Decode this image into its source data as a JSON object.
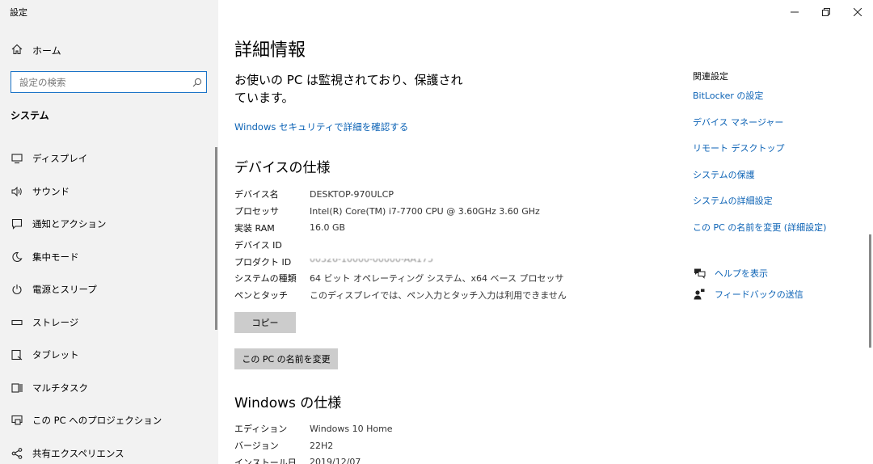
{
  "window": {
    "title": "設定"
  },
  "sidebar": {
    "home_label": "ホーム",
    "search_placeholder": "設定の検索",
    "section": "システム",
    "items": [
      {
        "label": "ディスプレイ",
        "icon": "display-icon"
      },
      {
        "label": "サウンド",
        "icon": "speaker-icon"
      },
      {
        "label": "通知とアクション",
        "icon": "notification-icon"
      },
      {
        "label": "集中モード",
        "icon": "moon-icon"
      },
      {
        "label": "電源とスリープ",
        "icon": "power-icon"
      },
      {
        "label": "ストレージ",
        "icon": "storage-icon"
      },
      {
        "label": "タブレット",
        "icon": "tablet-icon"
      },
      {
        "label": "マルチタスク",
        "icon": "multitask-icon"
      },
      {
        "label": "この PC へのプロジェクション",
        "icon": "projection-icon"
      },
      {
        "label": "共有エクスペリエンス",
        "icon": "share-icon"
      }
    ]
  },
  "main": {
    "title": "詳細情報",
    "protection_message": "お使いの PC は監視されており、保護されています。",
    "security_link": "Windows セキュリティで詳細を確認する",
    "device_spec": {
      "heading": "デバイスの仕様",
      "rows": [
        {
          "key": "デバイス名",
          "value": "DESKTOP-970ULCP"
        },
        {
          "key": "プロセッサ",
          "value": "Intel(R) Core(TM) i7-7700 CPU @ 3.60GHz   3.60 GHz"
        },
        {
          "key": "実装 RAM",
          "value": "16.0 GB"
        },
        {
          "key": "デバイス ID",
          "value": ""
        },
        {
          "key": "プロダクト ID",
          "value": "00326-10000-00000-AA175"
        },
        {
          "key": "システムの種類",
          "value": "64 ビット オペレーティング システム、x64 ベース プロセッサ"
        },
        {
          "key": "ペンとタッチ",
          "value": "このディスプレイでは、ペン入力とタッチ入力は利用できません"
        }
      ],
      "copy_button": "コピー",
      "rename_button": "この PC の名前を変更"
    },
    "windows_spec": {
      "heading": "Windows の仕様",
      "rows": [
        {
          "key": "エディション",
          "value": "Windows 10 Home"
        },
        {
          "key": "バージョン",
          "value": "22H2"
        },
        {
          "key": "インストール日",
          "value": "2019/12/07"
        }
      ]
    }
  },
  "related": {
    "heading": "関連設定",
    "links": [
      "BitLocker の設定",
      "デバイス マネージャー",
      "リモート デスクトップ",
      "システムの保護",
      "システムの詳細設定",
      "この PC の名前を変更 (詳細設定)"
    ],
    "help_label": "ヘルプを表示",
    "feedback_label": "フィードバックの送信"
  }
}
